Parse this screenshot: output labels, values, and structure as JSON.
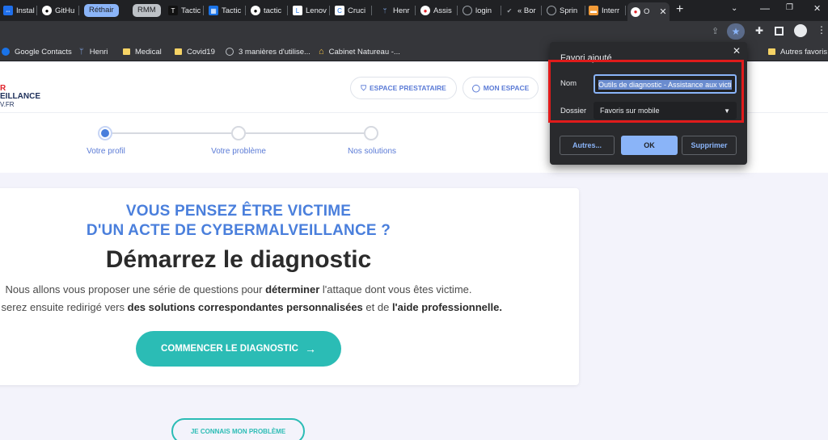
{
  "browser": {
    "tabs": [
      {
        "label": "Instal",
        "icon": "install-icon",
        "color": "#3b82f6"
      },
      {
        "label": "GitHu",
        "icon": "github-icon",
        "color": "#ffffff"
      },
      {
        "label": "Réthair",
        "icon": "",
        "color": ""
      },
      {
        "label": "RMM",
        "icon": "",
        "color": ""
      },
      {
        "label": "Tactic",
        "icon": "tactic-icon",
        "color": "#111111"
      },
      {
        "label": "Tactic",
        "icon": "tactic-grid-icon",
        "color": "#1a73e8"
      },
      {
        "label": "tactic",
        "icon": "github-icon",
        "color": "#ffffff"
      },
      {
        "label": "Lenov",
        "icon": "lenovo-icon",
        "color": "#ffffff"
      },
      {
        "label": "Cruci",
        "icon": "crucial-icon",
        "color": "#ffffff"
      },
      {
        "label": "Henr",
        "icon": "henri-icon",
        "color": "#5f6368"
      },
      {
        "label": "Assis",
        "icon": "assistance-icon",
        "color": "#ffffff"
      },
      {
        "label": "login",
        "icon": "globe-icon",
        "color": "#9aa0a6"
      },
      {
        "label": "« Bor",
        "icon": "check-icon",
        "color": "#9aa0a6"
      },
      {
        "label": "Sprin",
        "icon": "globe-icon",
        "color": "#9aa0a6"
      },
      {
        "label": "Interr",
        "icon": "ppt-icon",
        "color": "#f29b38"
      },
      {
        "label": "O",
        "icon": "cyber-icon",
        "color": "#ffffff"
      }
    ],
    "bookmarks": [
      {
        "label": "Google Contacts",
        "icon": "contacts-icon"
      },
      {
        "label": "Henri",
        "icon": "henri-icon"
      },
      {
        "label": "Medical",
        "icon": "folder-icon"
      },
      {
        "label": "Covid19",
        "icon": "folder-icon"
      },
      {
        "label": "3 manières d'utilise...",
        "icon": "globe-icon"
      },
      {
        "label": "Cabinet Natureau -...",
        "icon": "home-icon"
      },
      {
        "label": "Autres favoris",
        "icon": "folder-icon"
      }
    ]
  },
  "bookmark_popup": {
    "title": "Favori ajouté",
    "name_label": "Nom",
    "name_value": "Outils de diagnostic - Assistance aux victi",
    "folder_label": "Dossier",
    "folder_value": "Favoris sur mobile",
    "buttons": {
      "other": "Autres...",
      "ok": "OK",
      "delete": "Supprimer"
    }
  },
  "site": {
    "logo": {
      "line1": "R",
      "line2": "EILLANCE",
      "line3": "V.FR"
    },
    "header_buttons": {
      "provider": "ESPACE PRESTATAIRE",
      "my_space": "MON ESPACE"
    },
    "steps": [
      "Votre profil",
      "Votre problème",
      "Nos solutions"
    ],
    "headline_line1": "VOUS PENSEZ ÊTRE VICTIME",
    "headline_line2": "D'UN ACTE DE CYBERMALVEILLANCE ?",
    "title": "Démarrez le diagnostic",
    "para1": {
      "a": "Nous allons vous proposer une série de questions pour ",
      "b": "déterminer",
      "c": " l'attaque dont vous êtes victime."
    },
    "para2": {
      "a": "Vous serez ensuite redirigé vers ",
      "b": "des solutions correspondantes personnalisées",
      "c": " et de ",
      "d": "l'aide professionnelle."
    },
    "cta": "COMMENCER LE DIAGNOSTIC",
    "cta_arrow": "→",
    "known_problem": "JE CONNAIS MON PROBLÈME"
  },
  "colors": {
    "accent_blue": "#4a7fdc",
    "teal": "#2bbcb5",
    "logo_red": "#e0232b",
    "logo_navy": "#1d2f5a",
    "highlight_red": "#e01b1b"
  }
}
